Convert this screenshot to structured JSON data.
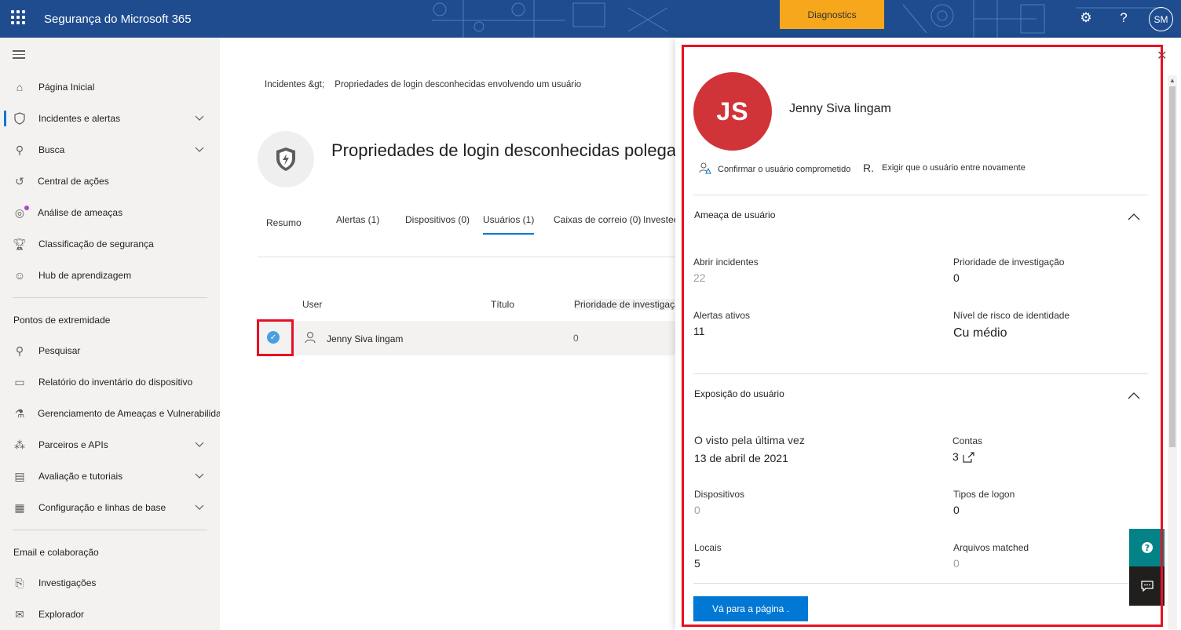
{
  "topbar": {
    "app_title": "Segurança do Microsoft 365",
    "diagnostics_label": "Diagnostics",
    "help_glyph": "?",
    "avatar_initials": "SM"
  },
  "nav": {
    "items": [
      {
        "label": "Página Inicial",
        "icon": "home-icon"
      },
      {
        "label": "Incidentes e alertas",
        "icon": "shield-icon",
        "expandable": true,
        "active": true
      },
      {
        "label": "Busca",
        "icon": "hunting-icon",
        "expandable": true
      },
      {
        "label": "Central de ações",
        "icon": "action-center-icon"
      },
      {
        "label": "Análise de ameaças",
        "icon": "threat-analytics-icon"
      },
      {
        "label": "Classificação de segurança",
        "icon": "trophy-icon"
      },
      {
        "label": "Hub de aprendizagem",
        "icon": "learning-icon"
      }
    ],
    "section_endpoints": "Pontos de extremidade",
    "endpoint_items": [
      {
        "label": "Pesquisar",
        "icon": "search-icon"
      },
      {
        "label": "Relatório do inventário do dispositivo",
        "icon": "laptop-icon"
      },
      {
        "label": "Gerenciamento de Ameaças e Vulnerabilidades",
        "icon": "tvm-icon"
      },
      {
        "label": "Parceiros e APIs",
        "icon": "partners-icon",
        "expandable": true
      },
      {
        "label": "Avaliação e tutoriais",
        "icon": "evaluation-icon",
        "expandable": true
      },
      {
        "label": "Configuração e linhas de base",
        "icon": "config-icon",
        "expandable": true
      }
    ],
    "section_email": "Email e colaboração",
    "email_items": [
      {
        "label": "Investigações",
        "icon": "investigations-icon"
      },
      {
        "label": "Explorador",
        "icon": "explorer-icon"
      }
    ]
  },
  "main": {
    "breadcrumb": {
      "parent": "Incidentes &gt;",
      "current": "Propriedades de login desconhecidas envolvendo um usuário"
    },
    "title": "Propriedades de login desconhecidas polegada",
    "tabs": [
      {
        "label": "Resumo"
      },
      {
        "label": "Alertas (1)"
      },
      {
        "label": "Dispositivos (0)"
      },
      {
        "label": "Usuários (1)",
        "active": true
      },
      {
        "label": "Caixas de correio (0)"
      },
      {
        "label": "Investee"
      }
    ],
    "table": {
      "headers": [
        "User",
        "Título",
        "Prioridade de investigação"
      ],
      "rows": [
        {
          "user": "Jenny Siva lingam",
          "title": "",
          "priority": "0",
          "selected": true
        }
      ]
    }
  },
  "panel": {
    "initials": "JS",
    "name": "Jenny Siva lingam",
    "actions": [
      {
        "label": "Confirmar o usuário comprometido",
        "icon": "user-warning-icon"
      },
      {
        "label": "Exigir que o usuário entre novamente",
        "prefix": "R."
      }
    ],
    "threat": {
      "title": "Ameaça de usuário",
      "open_incidents_label": "Abrir incidentes",
      "open_incidents_value": "22",
      "investigation_priority_label": "Prioridade de investigação",
      "investigation_priority_value": "0",
      "active_alerts_label": "Alertas ativos",
      "active_alerts_value": "11",
      "identity_risk_label": "Nível de risco de identidade",
      "identity_risk_value": "Cu médio"
    },
    "exposure": {
      "title": "Exposição do usuário",
      "last_seen_label": "O visto pela última vez",
      "last_seen_value": "13 de abril de 2021",
      "accounts_label": "Contas",
      "accounts_value": "3",
      "devices_label": "Dispositivos",
      "devices_value": "0",
      "logon_types_label": "Tipos de logon",
      "logon_types_value": "0",
      "locations_label": "Locais",
      "locations_value": "5",
      "files_label": "Arquivos matched",
      "files_value": "0"
    },
    "goto_label": "Vá para a página ."
  },
  "colors": {
    "topbar": "#1e4c8f",
    "diagnostics": "#f7a71c",
    "accent": "#0078d4",
    "highlight_frame": "#e81123",
    "avatar": "#d13438",
    "help_button": "#038387"
  }
}
